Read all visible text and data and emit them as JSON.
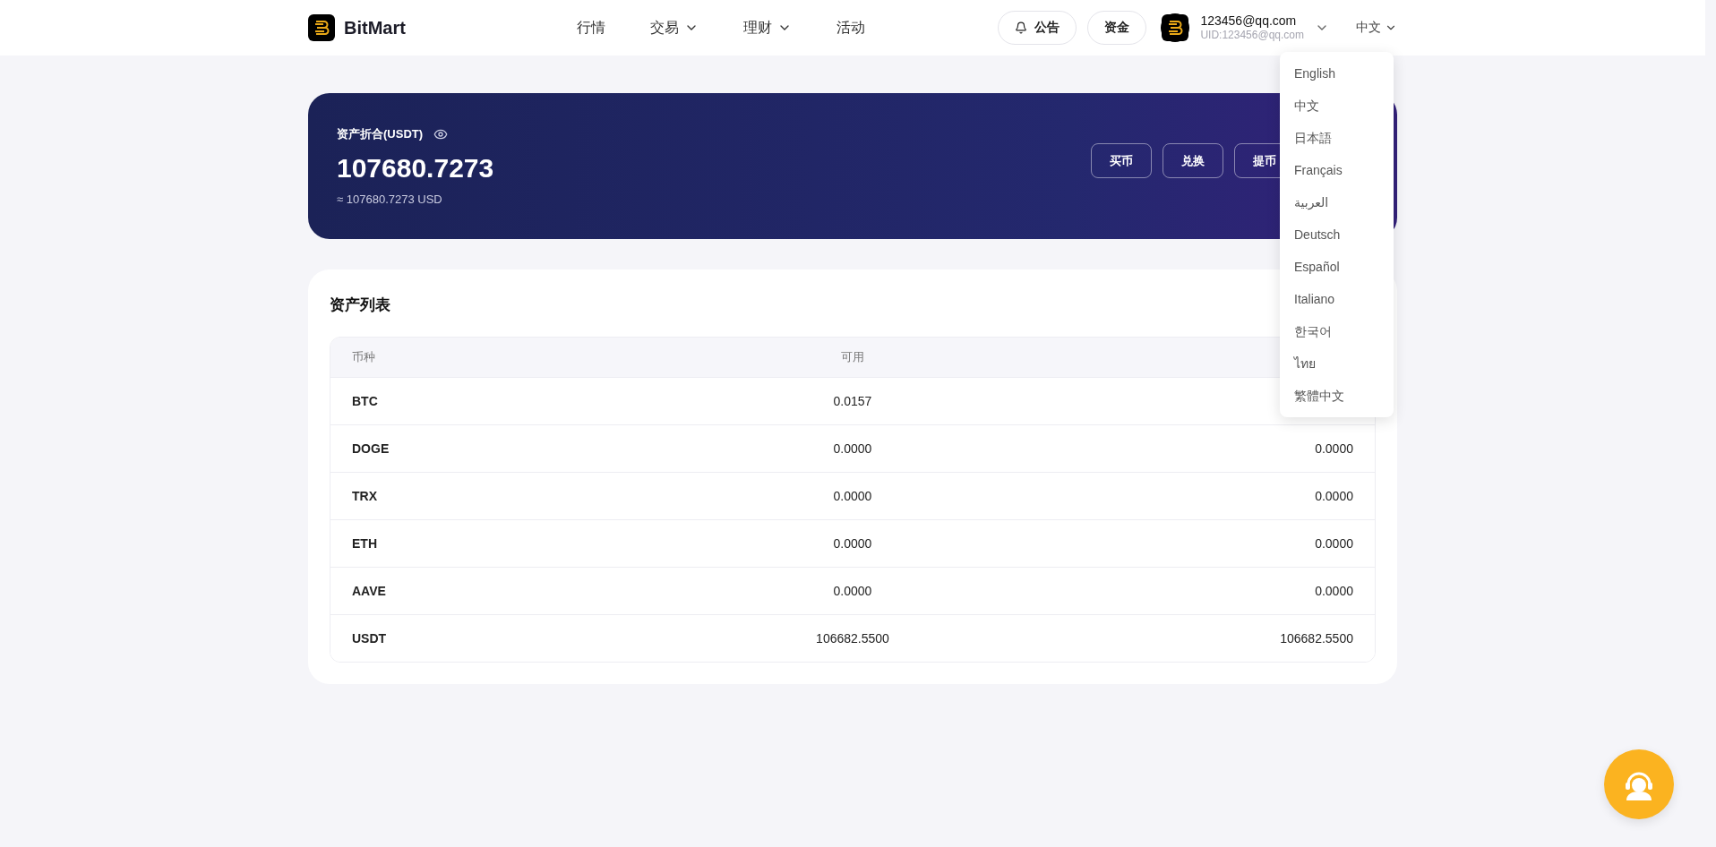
{
  "header": {
    "brand": "BitMart",
    "nav": [
      {
        "label": "行情",
        "dropdown": false
      },
      {
        "label": "交易",
        "dropdown": true
      },
      {
        "label": "理财",
        "dropdown": true
      },
      {
        "label": "活动",
        "dropdown": false
      }
    ],
    "notice_button": "公告",
    "funds_button": "资金",
    "user": {
      "email": "123456@qq.com",
      "uid": "UID:123456@qq.com"
    },
    "language": "中文"
  },
  "language_menu": [
    "English",
    "中文",
    "日本語",
    "Français",
    "العربية",
    "Deutsch",
    "Español",
    "Italiano",
    "한국어",
    "ไทย",
    "繁體中文"
  ],
  "banner": {
    "title": "资产折合(USDT)",
    "value": "107680.7273",
    "usd": "≈ 107680.7273 USD",
    "buttons": [
      "买币",
      "兑换",
      "提币"
    ]
  },
  "assets": {
    "title": "资产列表",
    "columns": [
      "币种",
      "可用"
    ],
    "rows": [
      {
        "coin": "BTC",
        "available": "0.0157"
      },
      {
        "coin": "DOGE",
        "available": "0.0000",
        "column_3": "0.0000"
      },
      {
        "coin": "TRX",
        "available": "0.0000",
        "column_3": "0.0000"
      },
      {
        "coin": "ETH",
        "available": "0.0000",
        "column_3": "0.0000"
      },
      {
        "coin": "AAVE",
        "available": "0.0000",
        "column_3": "0.0000"
      },
      {
        "coin": "USDT",
        "available": "106682.5500",
        "column_3": "106682.5500"
      }
    ]
  }
}
